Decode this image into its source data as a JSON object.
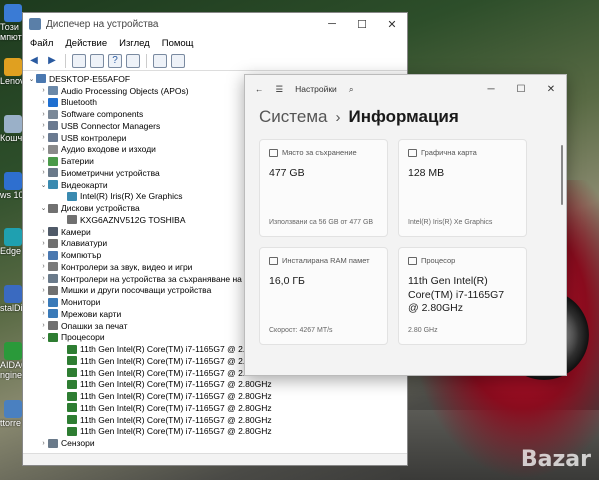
{
  "desktop": {
    "icons": [
      {
        "label": "Този",
        "label2": "мпюте",
        "color": "#3a7bd5"
      },
      {
        "label": "Lenovo",
        "color": "#e0a020"
      },
      {
        "label": "Кошче",
        "color": "#9ab0c8"
      },
      {
        "label": "ws 10",
        "color": "#2e6fcf"
      },
      {
        "label": "Edge",
        "color": "#1fa0b0"
      },
      {
        "label": "stalDis",
        "color": "#3a6ac0"
      },
      {
        "label": "AIDA64",
        "label2": "ngineer",
        "color": "#2a9a3a"
      },
      {
        "label": "ttorre",
        "color": "#4a80c0"
      }
    ],
    "watermark": "Bazar"
  },
  "device_manager": {
    "title": "Диспечер на устройства",
    "controls": {
      "minimize": "─",
      "maximize": "☐",
      "close": "✕"
    },
    "menu": [
      "Файл",
      "Действие",
      "Изглед",
      "Помощ"
    ],
    "tree": [
      {
        "level": 0,
        "arrow": "⌄",
        "icon": "computer-icon",
        "color": "#4a78b0",
        "label": "DESKTOP-E55AFOF"
      },
      {
        "level": 1,
        "arrow": "›",
        "icon": "apo-icon",
        "color": "#6a88a8",
        "label": "Audio Processing Objects (APOs)"
      },
      {
        "level": 1,
        "arrow": "›",
        "icon": "bluetooth-icon",
        "color": "#1f6fd0",
        "label": "Bluetooth"
      },
      {
        "level": 1,
        "arrow": "›",
        "icon": "software-icon",
        "color": "#7a8898",
        "label": "Software components"
      },
      {
        "level": 1,
        "arrow": "›",
        "icon": "usb-icon",
        "color": "#6a7a90",
        "label": "USB Connector Managers"
      },
      {
        "level": 1,
        "arrow": "›",
        "icon": "usb-icon",
        "color": "#6a7a90",
        "label": "USB контролери"
      },
      {
        "level": 1,
        "arrow": "›",
        "icon": "audio-icon",
        "color": "#8a8a8a",
        "label": "Аудио входове и изходи"
      },
      {
        "level": 1,
        "arrow": "›",
        "icon": "battery-icon",
        "color": "#4a9a4a",
        "label": "Батерии"
      },
      {
        "level": 1,
        "arrow": "›",
        "icon": "biometric-icon",
        "color": "#6a7a8a",
        "label": "Биометрични устройства"
      },
      {
        "level": 1,
        "arrow": "⌄",
        "icon": "display-icon",
        "color": "#3a8ab0",
        "label": "Видеокарти"
      },
      {
        "level": 2,
        "arrow": "",
        "icon": "display-icon",
        "color": "#3a8ab0",
        "label": "Intel(R) Iris(R) Xe Graphics"
      },
      {
        "level": 1,
        "arrow": "⌄",
        "icon": "disk-icon",
        "color": "#707070",
        "label": "Дискови устройства"
      },
      {
        "level": 2,
        "arrow": "",
        "icon": "disk-icon",
        "color": "#707070",
        "label": "KXG6AZNV512G TOSHIBA"
      },
      {
        "level": 1,
        "arrow": "›",
        "icon": "camera-icon",
        "color": "#505a68",
        "label": "Камери"
      },
      {
        "level": 1,
        "arrow": "›",
        "icon": "keyboard-icon",
        "color": "#707070",
        "label": "Клавиатури"
      },
      {
        "level": 1,
        "arrow": "›",
        "icon": "computer-icon",
        "color": "#4a78b0",
        "label": "Компютър"
      },
      {
        "level": 1,
        "arrow": "›",
        "icon": "sound-icon",
        "color": "#7a7a7a",
        "label": "Контролери за звук, видео и игри"
      },
      {
        "level": 1,
        "arrow": "›",
        "icon": "storage-icon",
        "color": "#6a7a8a",
        "label": "Контролери на устройства за съхраняване на данни"
      },
      {
        "level": 1,
        "arrow": "›",
        "icon": "mouse-icon",
        "color": "#707070",
        "label": "Мишки и други посочващи устройства"
      },
      {
        "level": 1,
        "arrow": "›",
        "icon": "monitor-icon",
        "color": "#3a7ab8",
        "label": "Монитори"
      },
      {
        "level": 1,
        "arrow": "›",
        "icon": "network-icon",
        "color": "#3a7ab8",
        "label": "Мрежови карти"
      },
      {
        "level": 1,
        "arrow": "›",
        "icon": "printer-icon",
        "color": "#707070",
        "label": "Опашки за печат"
      },
      {
        "level": 1,
        "arrow": "⌄",
        "icon": "cpu-icon",
        "color": "#2e7d32",
        "label": "Процесори"
      },
      {
        "level": 2,
        "arrow": "",
        "icon": "cpu-icon",
        "color": "#2e7d32",
        "label": "11th Gen Intel(R) Core(TM) i7-1165G7 @ 2.80GHz"
      },
      {
        "level": 2,
        "arrow": "",
        "icon": "cpu-icon",
        "color": "#2e7d32",
        "label": "11th Gen Intel(R) Core(TM) i7-1165G7 @ 2.80GHz"
      },
      {
        "level": 2,
        "arrow": "",
        "icon": "cpu-icon",
        "color": "#2e7d32",
        "label": "11th Gen Intel(R) Core(TM) i7-1165G7 @ 2.80GHz"
      },
      {
        "level": 2,
        "arrow": "",
        "icon": "cpu-icon",
        "color": "#2e7d32",
        "label": "11th Gen Intel(R) Core(TM) i7-1165G7 @ 2.80GHz"
      },
      {
        "level": 2,
        "arrow": "",
        "icon": "cpu-icon",
        "color": "#2e7d32",
        "label": "11th Gen Intel(R) Core(TM) i7-1165G7 @ 2.80GHz"
      },
      {
        "level": 2,
        "arrow": "",
        "icon": "cpu-icon",
        "color": "#2e7d32",
        "label": "11th Gen Intel(R) Core(TM) i7-1165G7 @ 2.80GHz"
      },
      {
        "level": 2,
        "arrow": "",
        "icon": "cpu-icon",
        "color": "#2e7d32",
        "label": "11th Gen Intel(R) Core(TM) i7-1165G7 @ 2.80GHz"
      },
      {
        "level": 2,
        "arrow": "",
        "icon": "cpu-icon",
        "color": "#2e7d32",
        "label": "11th Gen Intel(R) Core(TM) i7-1165G7 @ 2.80GHz"
      },
      {
        "level": 1,
        "arrow": "›",
        "icon": "sensor-icon",
        "color": "#6a7a8a",
        "label": "Сензори"
      }
    ]
  },
  "settings": {
    "app_title": "Настройки",
    "back": "←",
    "menu_icon": "☰",
    "search_icon": "⌕",
    "controls": {
      "minimize": "─",
      "maximize": "☐",
      "close": "✕"
    },
    "breadcrumb_parent": "Система",
    "breadcrumb_sep": "›",
    "breadcrumb_current": "Информация",
    "cards": [
      {
        "label": "Място за съхранение",
        "icon": "storage-icon",
        "value": "477 GB",
        "sub": "Използвани са 56 GB от 477 GB"
      },
      {
        "label": "Графична карта",
        "icon": "gpu-icon",
        "value": "128 MB",
        "sub": "Intel(R) Iris(R) Xe Graphics"
      },
      {
        "label": "Инсталирана RAM памет",
        "icon": "ram-icon",
        "value": "16,0 ГБ",
        "sub": "Скорост: 4267 MT/s"
      },
      {
        "label": "Процесор",
        "icon": "cpu-icon",
        "value": "11th Gen Intel(R) Core(TM) i7-1165G7 @ 2.80GHz",
        "sub": "2.80 GHz"
      }
    ]
  }
}
